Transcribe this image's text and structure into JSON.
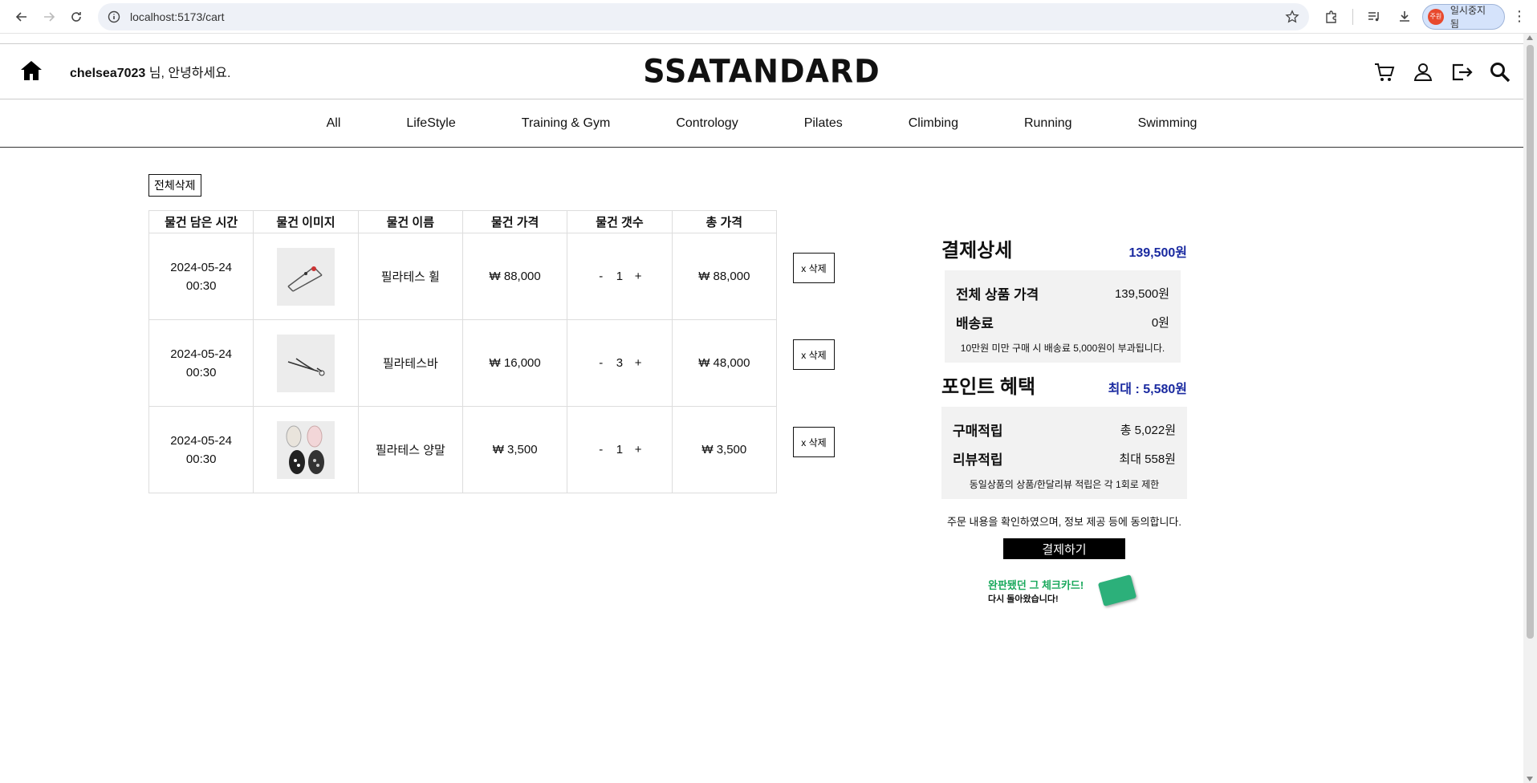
{
  "browser": {
    "url": "localhost:5173/cart",
    "profile_label": "일시중지됨",
    "profile_avatar": "주원"
  },
  "header": {
    "username": "chelsea7023",
    "greeting_suffix": " 님, 안녕하세요.",
    "brand": "SSATANDARD"
  },
  "categories": [
    "All",
    "LifeStyle",
    "Training & Gym",
    "Contrology",
    "Pilates",
    "Climbing",
    "Running",
    "Swimming"
  ],
  "cart": {
    "delete_all_label": "전체삭제",
    "columns": [
      "물건 담은 시간",
      "물건 이미지",
      "물건 이름",
      "물건 가격",
      "물건 갯수",
      "총 가격"
    ],
    "rows": [
      {
        "date": "2024-05-24",
        "time": "00:30",
        "name": "필라테스 휠",
        "price": "₩ 88,000",
        "qty": "1",
        "total": "₩ 88,000",
        "delete_label": "x 삭제"
      },
      {
        "date": "2024-05-24",
        "time": "00:30",
        "name": "필라테스바",
        "price": "₩ 16,000",
        "qty": "3",
        "total": "₩ 48,000",
        "delete_label": "x 삭제"
      },
      {
        "date": "2024-05-24",
        "time": "00:30",
        "name": "필라테스 양말",
        "price": "₩ 3,500",
        "qty": "1",
        "total": "₩ 3,500",
        "delete_label": "x 삭제"
      }
    ],
    "minus": "-",
    "plus": "+"
  },
  "summary": {
    "title": "결제상세",
    "total": "139,500원",
    "product_total_label": "전체 상품 가격",
    "product_total": "139,500원",
    "shipping_label": "배송료",
    "shipping": "0원",
    "shipping_note": "10만원 미만 구매 시 배송료 5,000원이 부과됩니다.",
    "points_title": "포인트 혜택",
    "points_max": "최대 : 5,580원",
    "purchase_points_label": "구매적립",
    "purchase_points": "총 5,022원",
    "review_points_label": "리뷰적립",
    "review_points": "최대 558원",
    "points_note": "동일상품의 상품/한달리뷰 적립은 각 1회로 제한",
    "agree_text": "주문 내용을 확인하였으며, 정보 제공 등에 동의합니다.",
    "pay_label": "결제하기",
    "banner_line1": "완판됐던 그 체크카드!",
    "banner_line2": "다시 돌아왔습니다!"
  },
  "colors": {
    "accent_blue": "#1a2aa0",
    "banner_green": "#18a85b"
  }
}
